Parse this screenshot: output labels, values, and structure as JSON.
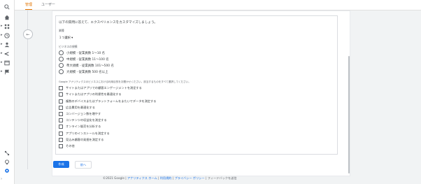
{
  "tabs": [
    {
      "label": "管理"
    },
    {
      "label": "ユーザー"
    }
  ],
  "intro": "以下の質問に答えて、エクスペリエンスをカスタマイズしましょう。",
  "industry": {
    "label": "業種",
    "value": "１つ選択 ▾"
  },
  "business_size": {
    "label": "ビジネスの規模",
    "options": [
      {
        "label": "小規模 - 従業員数 1～10 名"
      },
      {
        "label": "中規模 - 従業員数 11～100 名"
      },
      {
        "label": "準大規模 - 従業員数 101～500 名"
      },
      {
        "label": "大規模 - 従業員数 500 名以上"
      }
    ]
  },
  "usage": {
    "label": "Google アナリティクスのビジネスにおける利用目的をお聞かせください。該当するものをすべて選択してください。",
    "options": [
      {
        "label": "サイトまたはアプリでの顧客エンゲージメントを測定する"
      },
      {
        "label": "サイトまたはアプリの利便性を最適化する"
      },
      {
        "label": "複数のデバイスまたはプラットフォームをまたいでデータを測定する"
      },
      {
        "label": "広告費用を最適化する"
      },
      {
        "label": "コンバージョン数を増やす"
      },
      {
        "label": "コンテンツの収益化を測定する"
      },
      {
        "label": "オンライン販売を分析する"
      },
      {
        "label": "アプリのインストールを測定する"
      },
      {
        "label": "見込み顧客の発掘を測定する"
      },
      {
        "label": "その他"
      }
    ]
  },
  "buttons": {
    "create": "作成",
    "back": "前へ"
  },
  "footer": {
    "copyright": "©2021 Google | ",
    "home": "アナリティクス ホーム",
    "sep1": " | ",
    "terms": "利用規約",
    "sep2": " | ",
    "privacy": "プライバシー ポリシー",
    "sep3": " | ",
    "feedback": "フィードバックを送信"
  },
  "colors": {
    "accent": "#e37400",
    "primary": "#1a73e8"
  }
}
